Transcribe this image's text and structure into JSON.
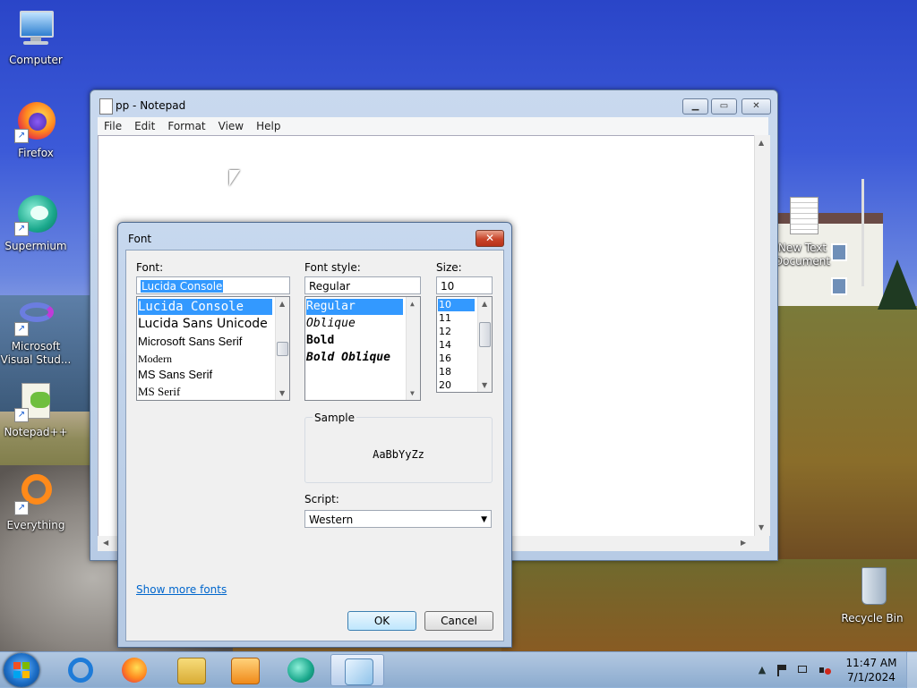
{
  "desktop": {
    "icons": [
      {
        "label": "Computer",
        "icon": "computer-icon"
      },
      {
        "label": "Firefox",
        "icon": "firefox-icon"
      },
      {
        "label": "Supermium",
        "icon": "supermium-icon"
      },
      {
        "label": "Microsoft Visual Stud...",
        "icon": "visual-studio-icon"
      },
      {
        "label": "Notepad++",
        "icon": "notepadpp-icon"
      },
      {
        "label": "Everything",
        "icon": "everything-icon"
      },
      {
        "label": "New Text Document",
        "icon": "text-document-icon"
      },
      {
        "label": "Recycle Bin",
        "icon": "recycle-bin-icon"
      }
    ]
  },
  "notepad": {
    "title": "pp - Notepad",
    "menu": [
      "File",
      "Edit",
      "Format",
      "View",
      "Help"
    ],
    "caption_buttons": {
      "minimize": "▁",
      "maximize": "▭",
      "close": "✕"
    }
  },
  "font_dialog": {
    "title": "Font",
    "close_glyph": "✕",
    "font_label": "Font:",
    "font_value": "Lucida Console",
    "font_list": [
      "Lucida Console",
      "Lucida Sans Unicode",
      "Microsoft Sans Serif",
      "Modern",
      "MS Sans Serif",
      "MS Serif"
    ],
    "style_label": "Font style:",
    "style_value": "Regular",
    "style_list": [
      "Regular",
      "Oblique",
      "Bold",
      "Bold Oblique"
    ],
    "size_label": "Size:",
    "size_value": "10",
    "size_list": [
      "10",
      "11",
      "12",
      "14",
      "16",
      "18",
      "20"
    ],
    "sample_label": "Sample",
    "sample_text": "AaBbYyZz",
    "script_label": "Script:",
    "script_value": "Western",
    "show_more": "Show more fonts",
    "ok": "OK",
    "cancel": "Cancel"
  },
  "taskbar": {
    "apps": [
      "internet-explorer-icon",
      "firefox-icon",
      "file-explorer-icon",
      "media-player-icon",
      "supermium-icon",
      "notepad-icon"
    ],
    "tray_arrow": "▲",
    "time": "11:47 AM",
    "date": "7/1/2024"
  },
  "colors": {
    "selection": "#3399ff",
    "link": "#0066cc",
    "titlebar": "#c7d8ee"
  }
}
